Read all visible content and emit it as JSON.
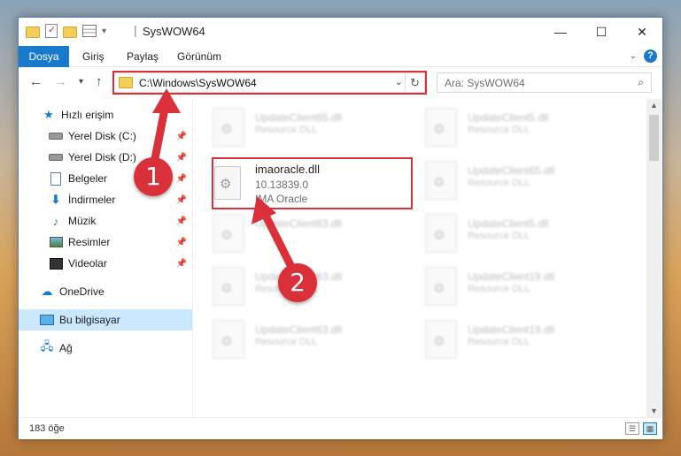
{
  "window": {
    "title": "SysWOW64",
    "controls": {
      "minimize": "—",
      "maximize": "☐",
      "close": "✕"
    }
  },
  "ribbon": {
    "tabs": [
      "Dosya",
      "Giriş",
      "Paylaş",
      "Görünüm"
    ],
    "help": "?"
  },
  "navigation": {
    "address": "C:\\Windows\\SysWOW64",
    "search_placeholder": "Ara: SysWOW64"
  },
  "sidebar": {
    "items": [
      {
        "label": "Hızlı erişim",
        "icon": "star-icon"
      },
      {
        "label": "Yerel Disk (C:)",
        "icon": "drive-icon",
        "pinned": true
      },
      {
        "label": "Yerel Disk (D:)",
        "icon": "drive-icon",
        "pinned": true
      },
      {
        "label": "Belgeler",
        "icon": "documents-icon",
        "pinned": true
      },
      {
        "label": "İndirmeler",
        "icon": "downloads-icon",
        "pinned": true
      },
      {
        "label": "Müzik",
        "icon": "music-icon",
        "pinned": true
      },
      {
        "label": "Resimler",
        "icon": "pictures-icon",
        "pinned": true
      },
      {
        "label": "Videolar",
        "icon": "videos-icon",
        "pinned": true
      },
      {
        "label": "OneDrive",
        "icon": "cloud-icon"
      },
      {
        "label": "Bu bilgisayar",
        "icon": "computer-icon",
        "selected": true
      },
      {
        "label": "Ağ",
        "icon": "network-icon"
      }
    ]
  },
  "files": {
    "highlighted": {
      "name": "imaoracle.dll",
      "version": "10.13839.0",
      "description": "IMA Oracle"
    },
    "background_tiles": [
      {
        "name": "UpdateClient65.dll",
        "desc": "Resource DLL"
      },
      {
        "name": "UpdateClient5.dll",
        "desc": "Resource DLL"
      },
      {
        "name": "UpdateClient65.dll",
        "desc": "Resource DLL"
      },
      {
        "name": "UpdateClient63.dll",
        "desc": "Resource DLL"
      },
      {
        "name": "UpdateClient5.dll",
        "desc": "Resource DLL"
      },
      {
        "name": "UpdateClient63.dll",
        "desc": "Resource DLL"
      },
      {
        "name": "UpdateClient19.dll",
        "desc": "Resource DLL"
      },
      {
        "name": "UpdateClient63.dll",
        "desc": "Resource DLL"
      },
      {
        "name": "UpdateClient19.dll",
        "desc": "Resource DLL"
      }
    ]
  },
  "status": {
    "item_count": "183 öğe"
  },
  "annotations": {
    "step1": "1",
    "step2": "2",
    "color": "#d9303a"
  }
}
